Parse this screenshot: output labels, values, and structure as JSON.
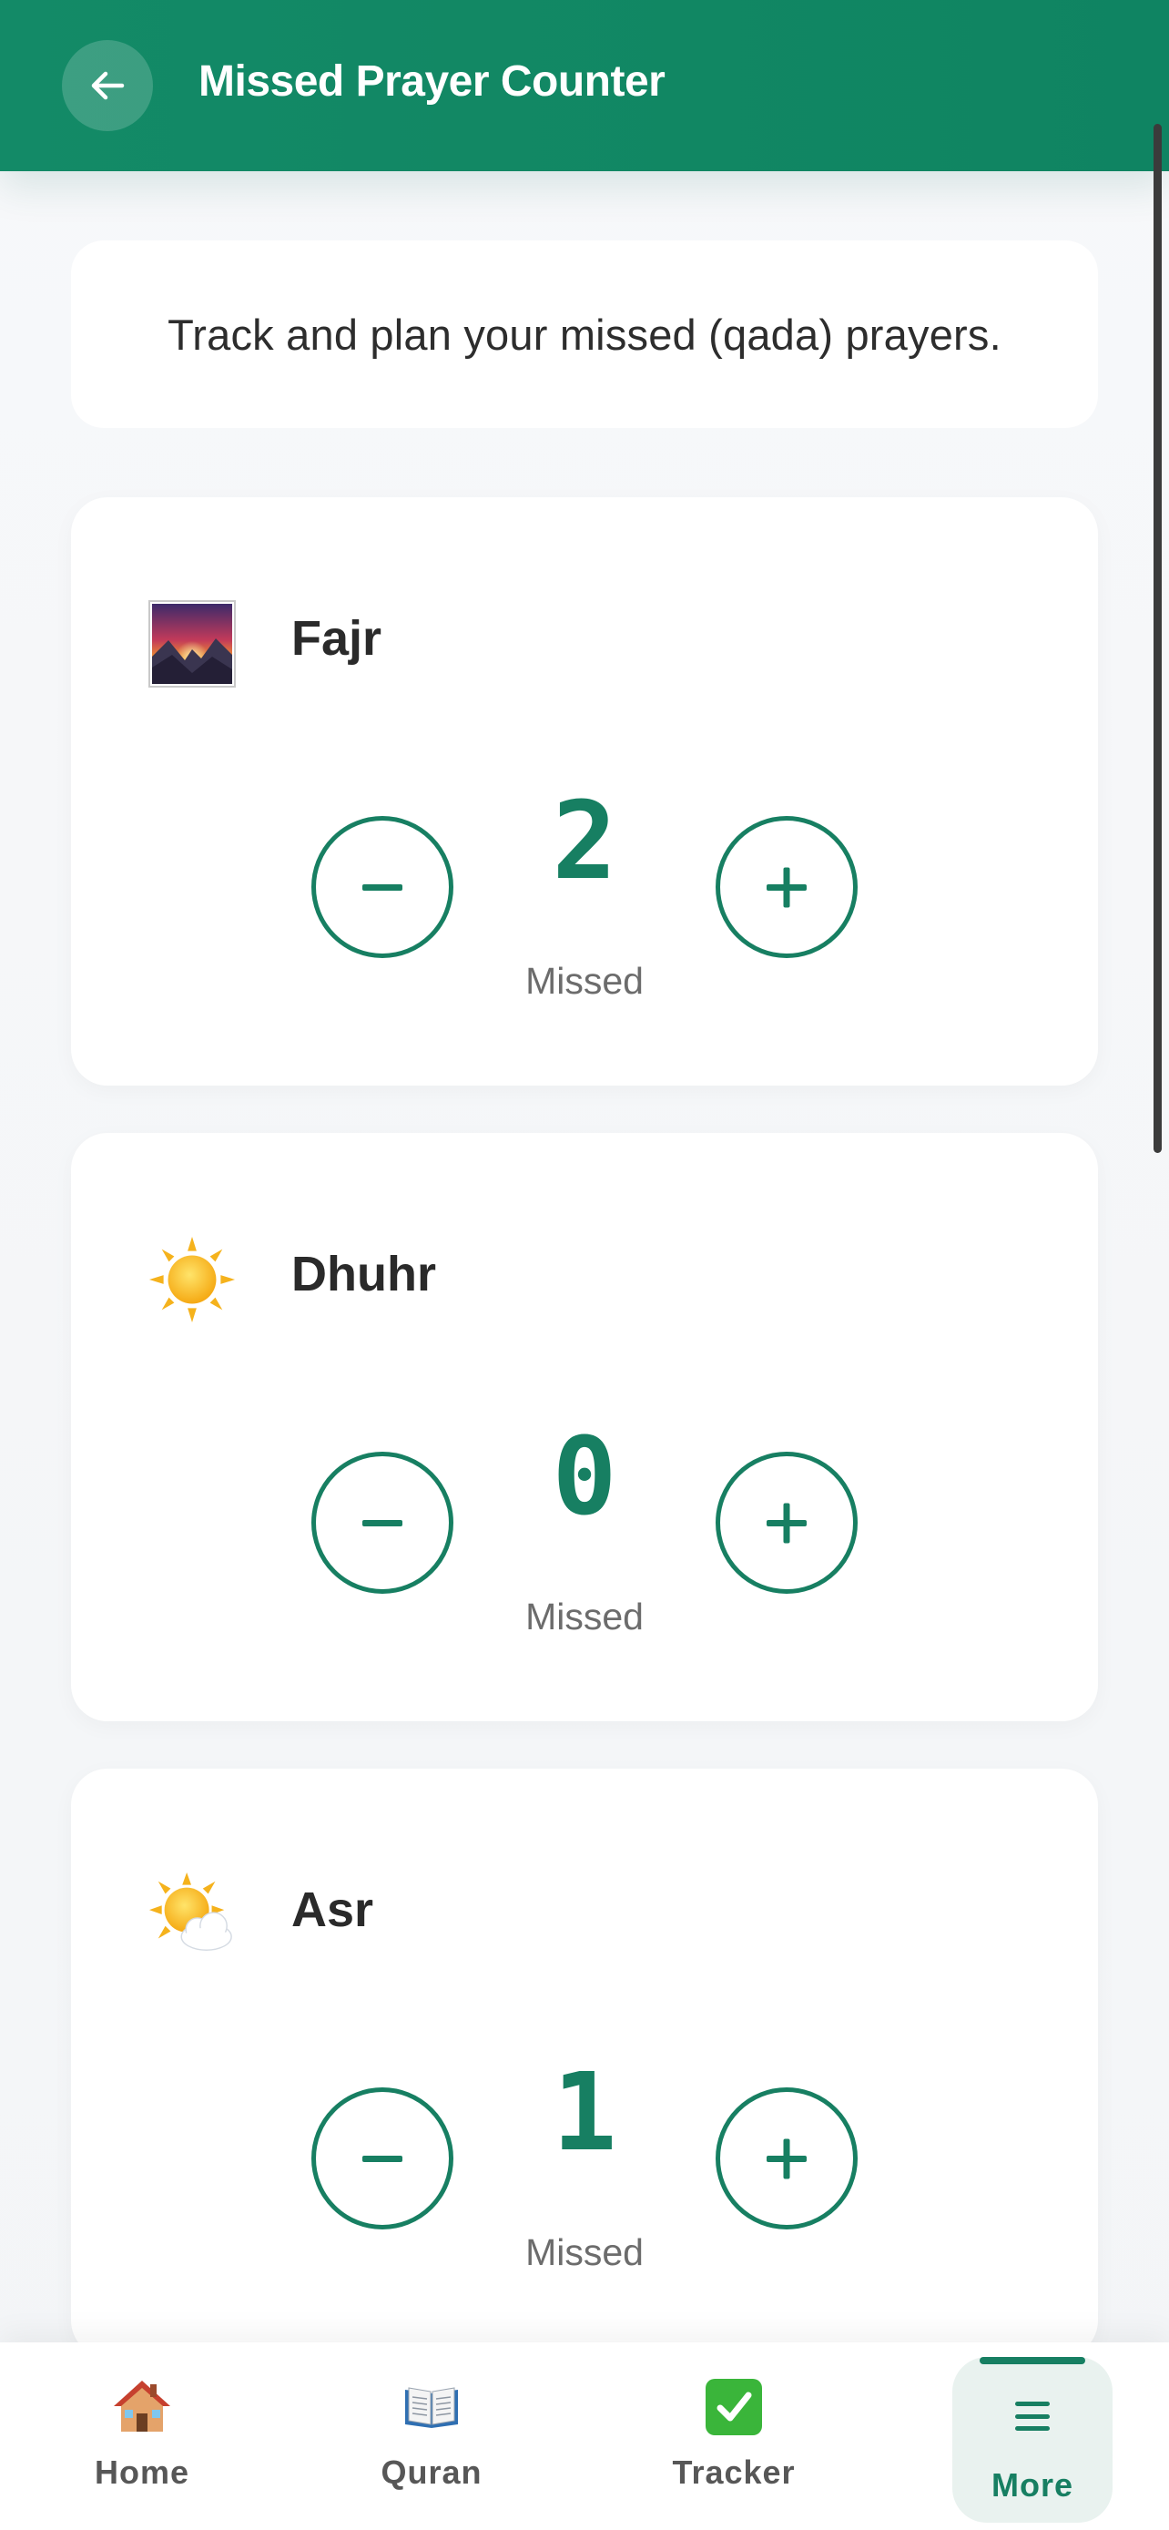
{
  "header": {
    "title": "Missed Prayer Counter",
    "back_icon": "arrow-left-icon"
  },
  "intro": {
    "text": "Track and plan your missed (qada) prayers."
  },
  "prayers": [
    {
      "name": "Fajr",
      "icon": "sunrise-over-mountains-icon",
      "count": "2",
      "label": "Missed"
    },
    {
      "name": "Dhuhr",
      "icon": "sun-icon",
      "count": "0",
      "label": "Missed"
    },
    {
      "name": "Asr",
      "icon": "sun-behind-cloud-icon",
      "count": "1",
      "label": "Missed"
    }
  ],
  "controls": {
    "minus_icon": "minus-icon",
    "plus_icon": "plus-icon"
  },
  "nav": {
    "items": [
      {
        "label": "Home",
        "icon": "house-icon"
      },
      {
        "label": "Quran",
        "icon": "open-book-icon"
      },
      {
        "label": "Tracker",
        "icon": "check-mark-icon"
      },
      {
        "label": "More",
        "icon": "menu-icon",
        "active": true
      }
    ]
  },
  "colors": {
    "brand": "#138a67",
    "accent": "#177f62",
    "active_tab_bg": "#e9f2ef"
  }
}
